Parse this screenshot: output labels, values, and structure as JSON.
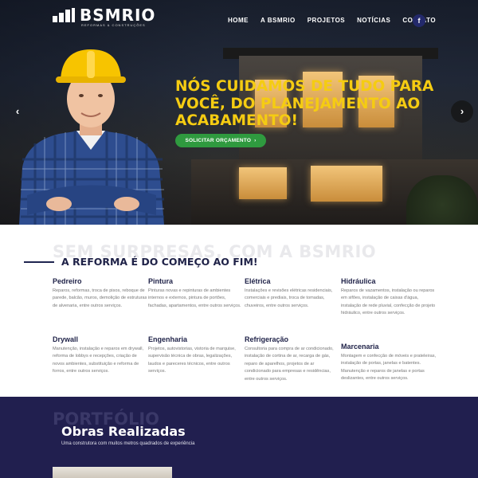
{
  "header": {
    "logo_text": "BSMRIO",
    "logo_sub": "REFORMAS & CONSTRUÇÕES",
    "nav": [
      "HOME",
      "A BSMRIO",
      "PROJETOS",
      "NOTÍCIAS",
      "CONTATO"
    ],
    "social_icon": "facebook-icon",
    "social_glyph": "f"
  },
  "hero": {
    "headline": [
      "NÓS CUIDAMOS DE TUDO PARA",
      "VOCÊ, DO PLANEJAMENTO AO",
      "ACABAMENTO!"
    ],
    "cta_label": "SOLICITAR ORÇAMENTO",
    "cta_icon": "chevron-right-icon",
    "prev_glyph": "‹",
    "next_glyph": "›",
    "headline_color": "#f5cc12",
    "cta_color": "#2f9a3f"
  },
  "services": {
    "ghost_text": "SEM SURPRESAS, COM A BSMRIO",
    "title": "A REFORMA É DO COMEÇO AO FIM!",
    "items": [
      {
        "title": "Pedreiro",
        "text": "Reparos, reformas, troca de pisos, reboque de parede, balcão, muros, demolição de estruturas de alvenaria, entre outros serviços."
      },
      {
        "title": "Pintura",
        "text": "Pinturas novas e repinturas de ambientes internos e externos, pintura de portões, fachadas, apartamentos, entre outros serviços."
      },
      {
        "title": "Elétrica",
        "text": "Instalações e revisões elétricas residenciais, comerciais e prediais, troca de tomadas, chuveiros, entre outros serviços."
      },
      {
        "title": "Hidráulica",
        "text": "Reparos de vazamentos, instalação ou reparos em sifões, instalação de caixas d'água, instalação de rede pluvial, confecção de projeto hidráulico, entre outros serviços."
      },
      {
        "title": "Drywall",
        "text": "Manutenção, instalação e reparos em drywall, reforma de lobbys e recepções, criação de novos ambientes, substituição e reforma de forros, entre outros serviços."
      },
      {
        "title": "Engenharia",
        "text": "Projetos, autovistorias, vistoria de marquise, supervisão técnica de obras, legalizações, laudos e pareceres técnicos, entre outros serviços."
      },
      {
        "title": "Refrigeração",
        "text": "Consultoria para compra de ar condicionado, instalação de cortina de ar, recarga de gás, reparo de aparelhos, projetos de ar condicionado para empresas e residências, entre outros serviços."
      },
      {
        "title": "Marcenaria",
        "text": "Montagem e confecção de móveis e prateleiras, instalação de portas, janelas e batentes. Manutenção e reparos de janelas e portas deslizantes, entre outros serviços."
      }
    ]
  },
  "portfolio": {
    "ghost_text": "PORTFÓLIO",
    "title": "Obras Realizadas",
    "subtitle": "Uma construtora com muitos metros quadrados de experiência",
    "bg_color": "#211f4f"
  }
}
